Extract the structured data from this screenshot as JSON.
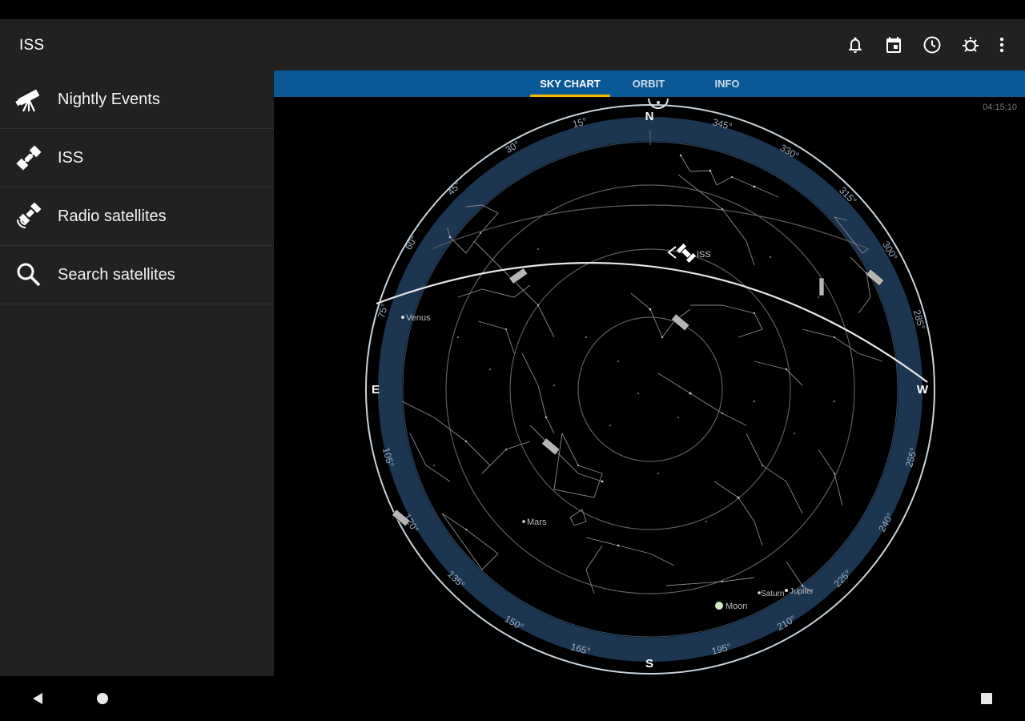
{
  "app": {
    "title": "ISS"
  },
  "toolbar": {
    "actions": [
      "bell-icon",
      "calendar-icon",
      "clock-icon",
      "sun-icon",
      "more-vert-icon"
    ]
  },
  "drawer": {
    "items": [
      {
        "label": "Nightly Events",
        "icon": "telescope-icon"
      },
      {
        "label": "ISS",
        "icon": "satellite-icon"
      },
      {
        "label": "Radio satellites",
        "icon": "radio-satellite-icon"
      },
      {
        "label": "Search satellites",
        "icon": "search-icon"
      }
    ]
  },
  "tabs": [
    {
      "label": "SKY CHART",
      "active": true
    },
    {
      "label": "ORBIT",
      "active": false
    },
    {
      "label": "INFO",
      "active": false
    }
  ],
  "sky": {
    "time": "04:15:10",
    "cardinals": {
      "north": "N",
      "east": "E",
      "south": "S",
      "west": "W"
    },
    "degree_labels": [
      "15°",
      "30°",
      "45°",
      "60°",
      "75°",
      "105°",
      "120°",
      "135°",
      "150°",
      "165°",
      "195°",
      "210°",
      "225°",
      "240°",
      "255°",
      "285°",
      "300°",
      "315°",
      "330°",
      "345°"
    ],
    "objects": {
      "venus": "Venus",
      "mars": "Mars",
      "moon": "Moon",
      "saturn": "Saturn",
      "jupiter": "Jupiter",
      "iss": "ISS"
    }
  },
  "colors": {
    "app_bar": "#212121",
    "tab_bar": "#0a5896",
    "tab_indicator": "#f4b400",
    "horizon_ring": "#1c3550"
  }
}
